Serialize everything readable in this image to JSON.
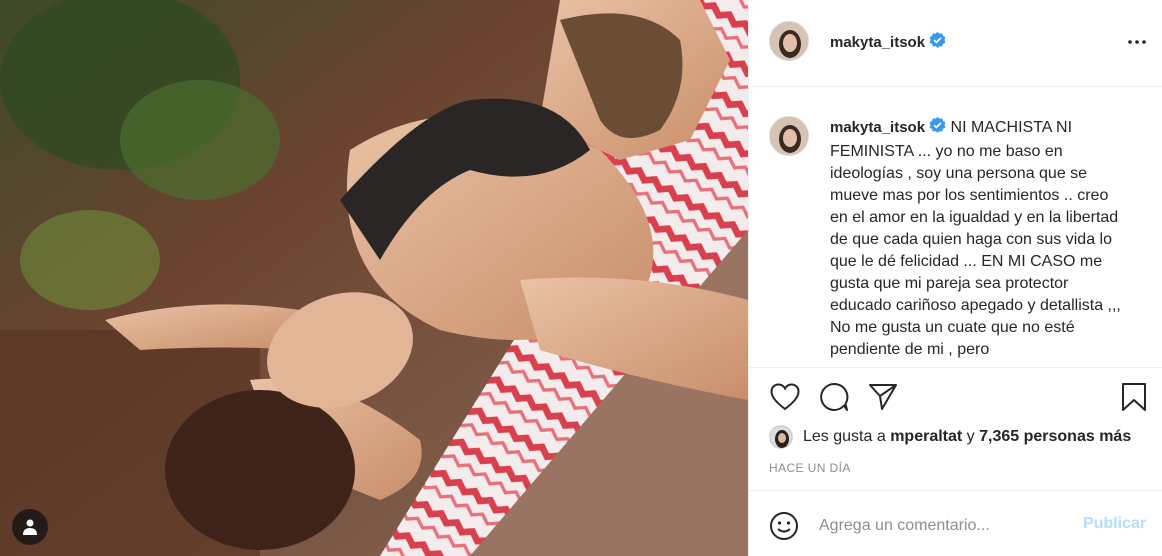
{
  "post": {
    "username": "makyta_itsok",
    "verified": true,
    "caption": "NI MACHISTA NI FEMINISTA ... yo no me baso en ideologías , soy una persona que se mueve mas por los sentimientos .. creo en el amor en la igualdad y en la libertad de que cada quien haga con sus vida lo que le dé felicidad ... EN MI CASO me gusta que mi pareja sea protector educado cariñoso apegado y detallista ,,, No me gusta un cuate que no esté pendiente de mi , pero",
    "timestamp": "HACE UN DÍA"
  },
  "likes": {
    "prefix": "Les gusta a",
    "user": "mperaltat",
    "connector": "y",
    "others": "7,365 personas más"
  },
  "comment": {
    "placeholder": "Agrega un comentario...",
    "publish_label": "Publicar"
  },
  "icons": {
    "more": "more-horizontal-icon",
    "like": "heart-icon",
    "comment": "comment-icon",
    "share": "paper-plane-icon",
    "save": "bookmark-icon",
    "emoji": "smiley-icon",
    "tag": "person-icon"
  },
  "colors": {
    "verified": "#3897f0",
    "publish_disabled": "#b2dffc",
    "muted": "#8e8e8e"
  }
}
